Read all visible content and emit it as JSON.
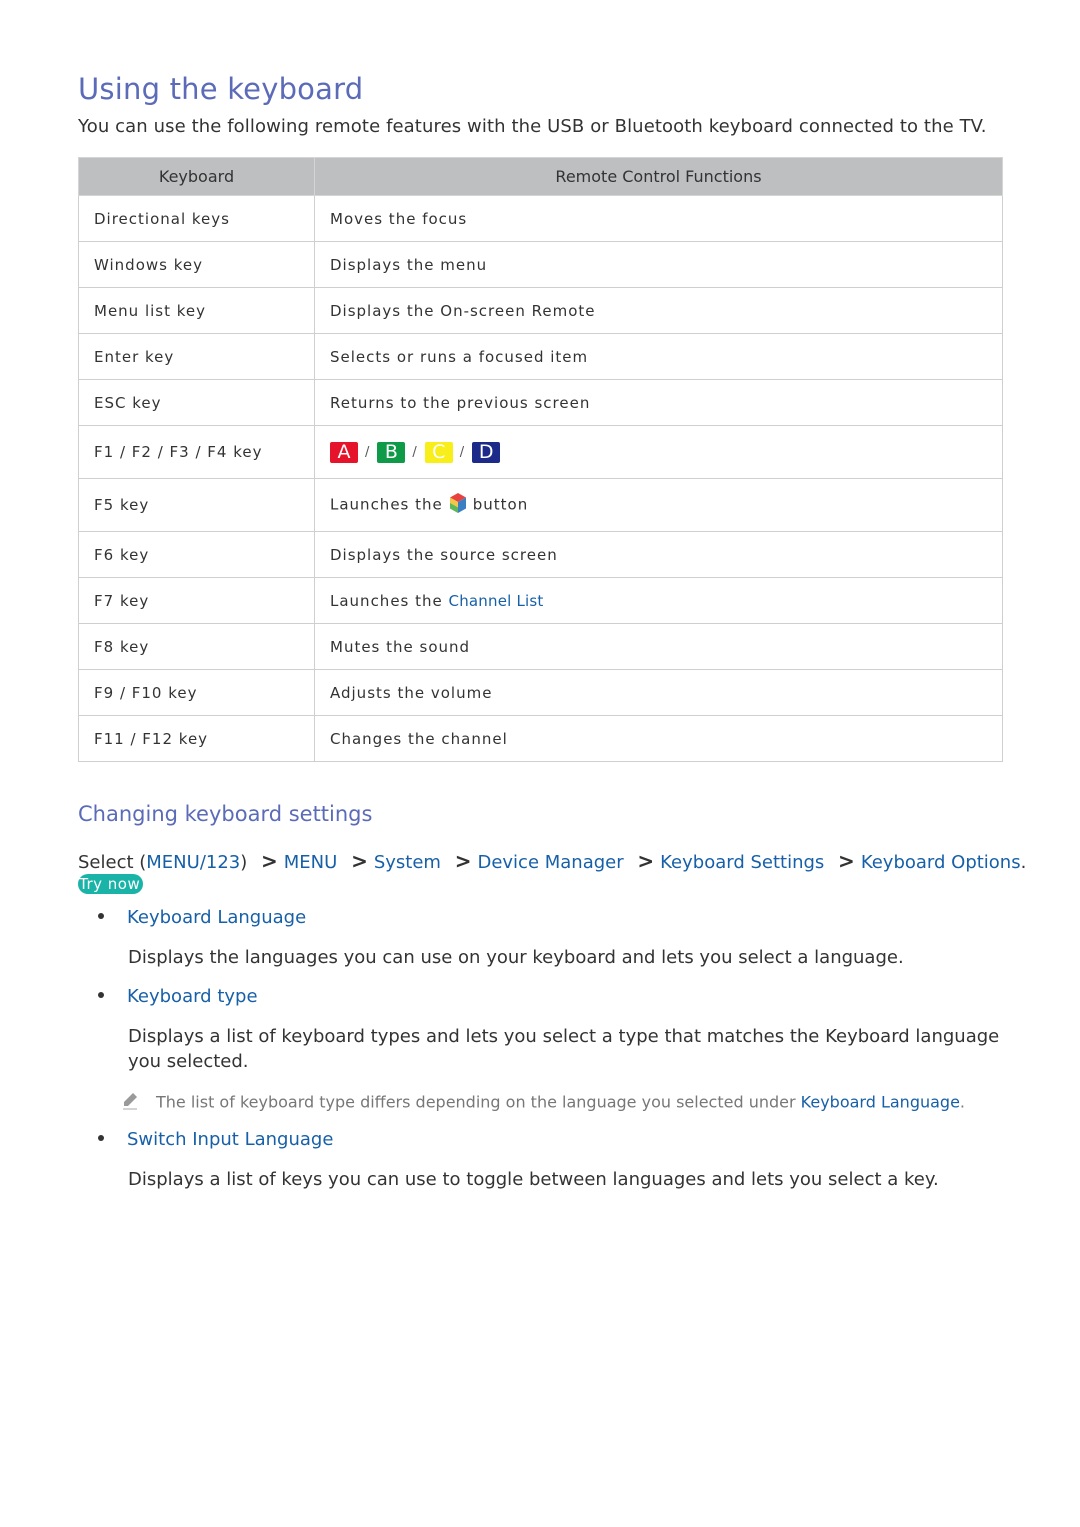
{
  "title": "Using the keyboard",
  "intro": "You can use the following remote features with the USB or Bluetooth keyboard connected to the TV.",
  "table": {
    "headers": [
      "Keyboard",
      "Remote Control Functions"
    ],
    "rows": [
      {
        "key": "Directional keys",
        "function": "Moves the focus"
      },
      {
        "key": "Windows key",
        "function": "Displays the menu"
      },
      {
        "key": "Menu list key",
        "function": "Displays the On-screen Remote"
      },
      {
        "key": "Enter key",
        "function": "Selects or runs a focused item"
      },
      {
        "key": "ESC key",
        "function": "Returns to the previous screen"
      },
      {
        "key": "F1 / F2 / F3 / F4 key",
        "color_buttons": [
          {
            "label": "A",
            "color": "#e5142a"
          },
          {
            "label": "B",
            "color": "#0f9a48"
          },
          {
            "label": "C",
            "color": "#f7ee1a"
          },
          {
            "label": "D",
            "color": "#1c2b8a"
          }
        ],
        "separator": "/"
      },
      {
        "key": "F5 key",
        "function_prefix": "Launches the",
        "function_icon": "smart-hub-cube-icon",
        "function_suffix": "button"
      },
      {
        "key": "F6 key",
        "function": "Displays the source screen"
      },
      {
        "key": "F7 key",
        "function_prefix": "Launches the",
        "function_link": "Channel List"
      },
      {
        "key": "F8 key",
        "function": "Mutes the sound"
      },
      {
        "key": "F9 / F10 key",
        "function": "Adjusts the volume"
      },
      {
        "key": "F11 / F12 key",
        "function": "Changes the channel"
      }
    ]
  },
  "section": {
    "title": "Changing keyboard settings",
    "path_prefix": "Select (",
    "path_first": "MENU/123",
    "path_first_suffix": ")",
    "path_items": [
      "MENU",
      "System",
      "Device Manager",
      "Keyboard Settings",
      "Keyboard Options"
    ],
    "path_end": ".",
    "try_now": "Try now",
    "items": [
      {
        "title": "Keyboard Language",
        "description": "Displays the languages you can use on your keyboard and lets you select a language."
      },
      {
        "title": "Keyboard type",
        "description": "Displays a list of keyboard types and lets you select a type that matches the Keyboard language you selected."
      },
      {
        "title": "Switch Input Language",
        "description": "Displays a list of keys you can use to toggle between languages and lets you select a key."
      }
    ],
    "note": {
      "text": "The list of keyboard type differs depending on the language you selected under",
      "link": "Keyboard Language",
      "end": "."
    }
  }
}
